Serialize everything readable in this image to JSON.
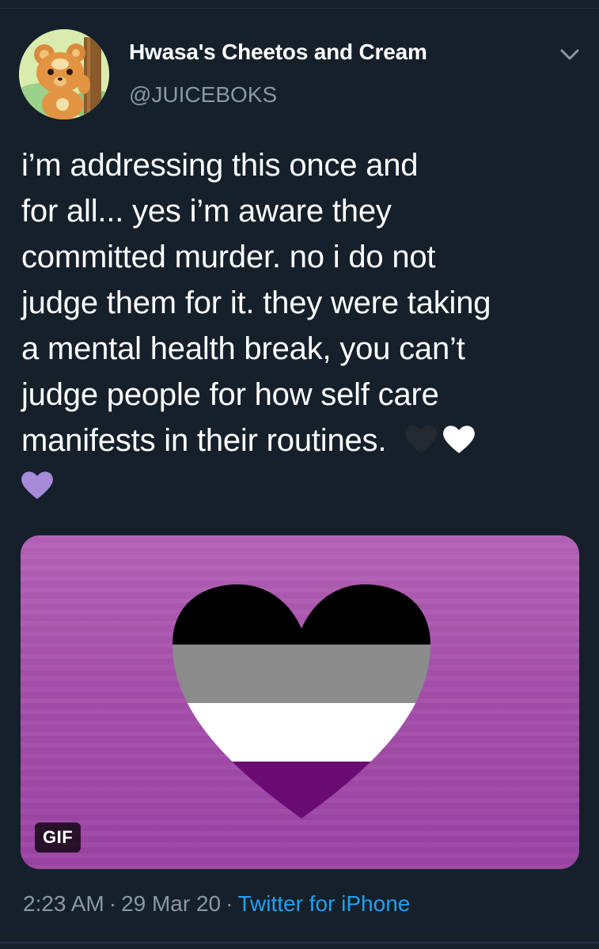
{
  "tweet": {
    "author": {
      "display_name": "Hwasa's Cheetos and Cream",
      "handle": "@JUICEBOKS",
      "avatar_icon": "teddiursa-avatar"
    },
    "text_lines": [
      "i’m addressing this once and",
      "for all... yes i’m aware they",
      "committed murder. no i do not",
      "judge them for it. they were taking",
      "a mental health break, you can’t",
      "judge people for how self care",
      "manifests in their routines."
    ],
    "emojis": [
      "black-heart",
      "white-heart",
      "purple-heart"
    ],
    "media": {
      "badge": "GIF",
      "content_icon": "asexual-flag-heart"
    },
    "time": "2:23 AM",
    "date": "29 Mar 20",
    "separator": "·",
    "source": "Twitter for iPhone"
  },
  "colors": {
    "background": "#15202b",
    "secondary_text": "#8899a6",
    "link": "#1da1f2",
    "media_purple": "#a54fab"
  }
}
